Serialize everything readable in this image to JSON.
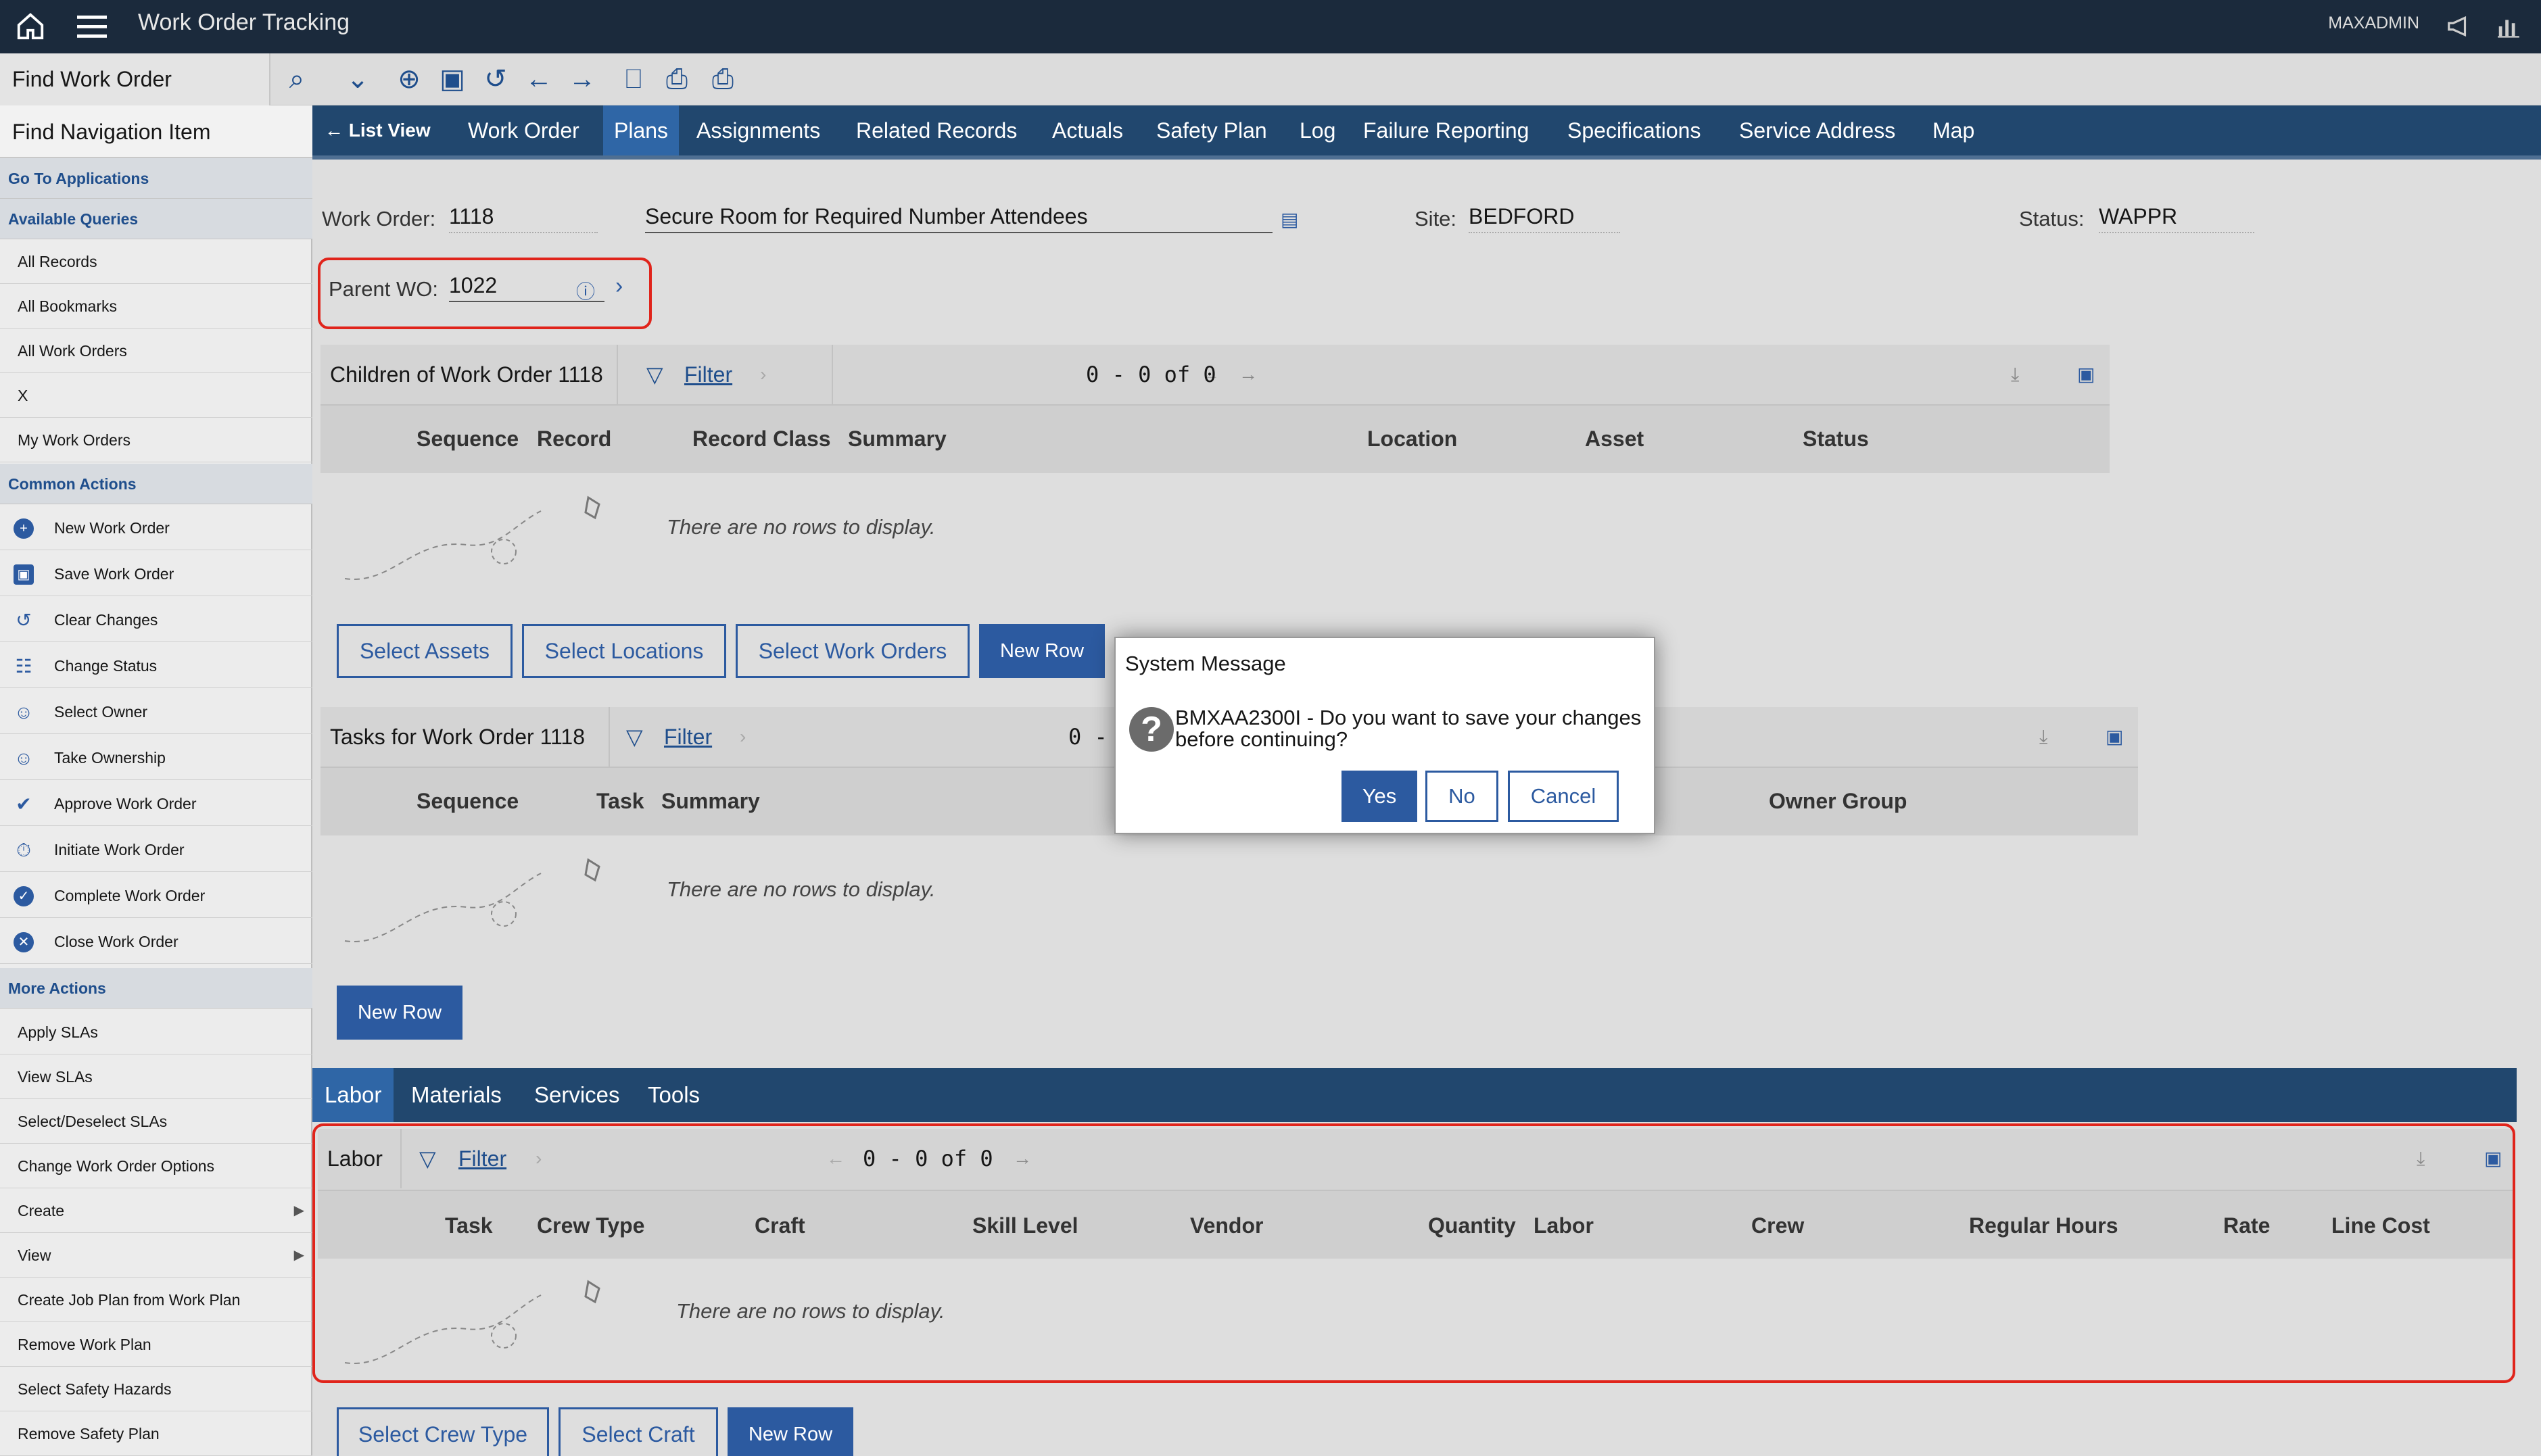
{
  "app": {
    "title": "Work Order Tracking",
    "user": "MAXADMIN"
  },
  "toolbar": {
    "find_label": "Find Work Order"
  },
  "sidebar": {
    "find_nav": "Find Navigation Item",
    "go_to": "Go To Applications",
    "available_queries": "Available Queries",
    "queries": [
      "All Records",
      "All Bookmarks",
      "All Work Orders",
      "X",
      "My Work Orders"
    ],
    "common_actions": "Common Actions",
    "common": [
      "New Work Order",
      "Save Work Order",
      "Clear Changes",
      "Change Status",
      "Select Owner",
      "Take Ownership",
      "Approve Work Order",
      "Initiate Work Order",
      "Complete Work Order",
      "Close Work Order"
    ],
    "more_actions": "More Actions",
    "more": [
      "Apply SLAs",
      "View SLAs",
      "Select/Deselect SLAs",
      "Change Work Order Options",
      "Create",
      "View",
      "Create Job Plan from Work Plan",
      "Remove Work Plan",
      "Select Safety Hazards",
      "Remove Safety Plan"
    ]
  },
  "tabs": {
    "list_view": "List View",
    "items": [
      "Work Order",
      "Plans",
      "Assignments",
      "Related Records",
      "Actuals",
      "Safety Plan",
      "Log",
      "Failure Reporting",
      "Specifications",
      "Service Address",
      "Map"
    ],
    "active": "Plans"
  },
  "header": {
    "wo_label": "Work Order:",
    "wo_value": "1118",
    "description": "Secure Room for Required Number Attendees",
    "site_label": "Site:",
    "site_value": "BEDFORD",
    "status_label": "Status:",
    "status_value": "WAPPR",
    "parent_label": "Parent WO:",
    "parent_value": "1022"
  },
  "children": {
    "title": "Children of Work Order 1118",
    "filter": "Filter",
    "pager": "0 - 0 of 0",
    "columns": [
      "Sequence",
      "Record",
      "Record Class",
      "Summary",
      "Location",
      "Asset",
      "Status"
    ],
    "empty": "There are no rows to display.",
    "buttons": [
      "Select Assets",
      "Select Locations",
      "Select Work Orders",
      "New Row"
    ]
  },
  "tasks": {
    "title": "Tasks for Work Order 1118",
    "filter": "Filter",
    "pager": "0 -",
    "columns": [
      "Sequence",
      "Task",
      "Summary",
      "Owner Group"
    ],
    "empty": "There are no rows to display.",
    "new_row": "New Row"
  },
  "subtabs": {
    "items": [
      "Labor",
      "Materials",
      "Services",
      "Tools"
    ],
    "active": "Labor"
  },
  "labor": {
    "title": "Labor",
    "filter": "Filter",
    "pager": "0 - 0 of 0",
    "columns": [
      "Task",
      "Crew Type",
      "Craft",
      "Skill Level",
      "Vendor",
      "Quantity",
      "Labor",
      "Crew",
      "Regular Hours",
      "Rate",
      "Line Cost"
    ],
    "empty": "There are no rows to display.",
    "buttons": [
      "Select Crew Type",
      "Select Craft",
      "New Row"
    ]
  },
  "dialog": {
    "title": "System Message",
    "message": "BMXAA2300I - Do you want to save your changes before continuing?",
    "yes": "Yes",
    "no": "No",
    "cancel": "Cancel"
  },
  "colors": {
    "header_bg": "#1b2a3c",
    "tab_bg": "#21476e",
    "accent": "#2c5aa0",
    "highlight": "#e0241b"
  }
}
